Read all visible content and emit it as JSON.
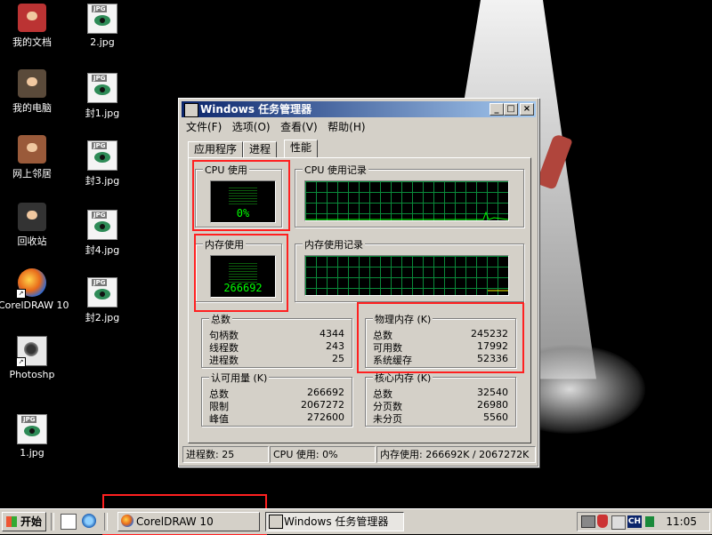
{
  "desktop": {
    "icons": [
      {
        "label": "我的文档"
      },
      {
        "label": "2.jpg"
      },
      {
        "label": "我的电脑"
      },
      {
        "label": "封1.jpg"
      },
      {
        "label": "网上邻居"
      },
      {
        "label": "封3.jpg"
      },
      {
        "label": "回收站"
      },
      {
        "label": "封4.jpg"
      },
      {
        "label": "CorelDRAW 10"
      },
      {
        "label": "封2.jpg"
      },
      {
        "label": "Photoshp"
      },
      {
        "label": "1.jpg"
      }
    ],
    "jpg_badge": "JPG"
  },
  "window": {
    "title": "Windows 任务管理器",
    "controls": {
      "minimize": "_",
      "maximize": "□",
      "close": "×"
    },
    "menu": [
      "文件(F)",
      "选项(O)",
      "查看(V)",
      "帮助(H)"
    ],
    "tabs": [
      {
        "label": "应用程序",
        "active": false
      },
      {
        "label": "进程",
        "active": false
      },
      {
        "label": "性能",
        "active": true
      }
    ],
    "cpu_usage": {
      "title": "CPU 使用",
      "value": "0%"
    },
    "cpu_history": {
      "title": "CPU 使用记录"
    },
    "mem_usage": {
      "title": "内存使用",
      "value": "266692"
    },
    "mem_history": {
      "title": "内存使用记录"
    },
    "totals": {
      "title": "总数",
      "rows": [
        {
          "label": "句柄数",
          "value": "4344"
        },
        {
          "label": "线程数",
          "value": "243"
        },
        {
          "label": "进程数",
          "value": "25"
        }
      ]
    },
    "physical": {
      "title": "物理内存 (K)",
      "rows": [
        {
          "label": "总数",
          "value": "245232"
        },
        {
          "label": "可用数",
          "value": "17992"
        },
        {
          "label": "系统缓存",
          "value": "52336"
        }
      ]
    },
    "commit": {
      "title": "认可用量 (K)",
      "rows": [
        {
          "label": "总数",
          "value": "266692"
        },
        {
          "label": "限制",
          "value": "2067272"
        },
        {
          "label": "峰值",
          "value": "272600"
        }
      ]
    },
    "kernel": {
      "title": "核心内存 (K)",
      "rows": [
        {
          "label": "总数",
          "value": "32540"
        },
        {
          "label": "分页数",
          "value": "26980"
        },
        {
          "label": "未分页",
          "value": "5560"
        }
      ]
    },
    "status": {
      "processes": "进程数: 25",
      "cpu": "CPU 使用: 0%",
      "memory": "内存使用: 266692K / 2067272K"
    }
  },
  "taskbar": {
    "start_label": "开始",
    "buttons": [
      {
        "label": "CorelDRAW 10",
        "pressed": false
      },
      {
        "label": "Windows 任务管理器",
        "pressed": true
      }
    ],
    "tray": {
      "ime": "CH",
      "clock": "11:05"
    }
  },
  "colors": {
    "title_start": "#0a246a",
    "title_end": "#a6caf0",
    "window_face": "#d4d0c8",
    "meter_green": "#00ff00",
    "grid_green": "#0a8a3a",
    "annotation_red": "#ff2020"
  }
}
